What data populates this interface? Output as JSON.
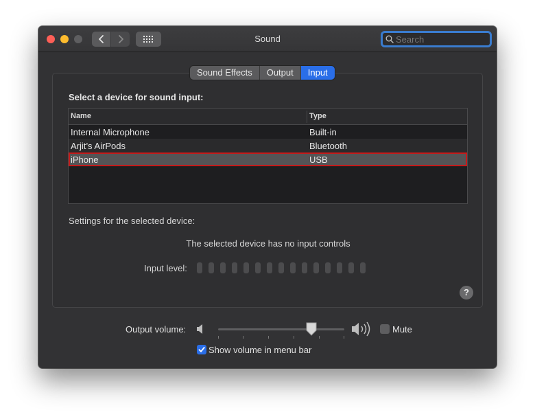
{
  "window": {
    "title": "Sound"
  },
  "search": {
    "placeholder": "Search"
  },
  "tabs": [
    {
      "label": "Sound Effects",
      "active": false
    },
    {
      "label": "Output",
      "active": false
    },
    {
      "label": "Input",
      "active": true
    }
  ],
  "input": {
    "heading": "Select a device for sound input:",
    "columns": {
      "name": "Name",
      "type": "Type"
    },
    "devices": [
      {
        "name": "Internal Microphone",
        "type": "Built-in",
        "selected": false
      },
      {
        "name": "Arjit’s AirPods",
        "type": "Bluetooth",
        "selected": false
      },
      {
        "name": "iPhone",
        "type": "USB",
        "selected": true
      }
    ],
    "settings_label": "Settings for the selected device:",
    "no_controls_text": "The selected device has no input controls",
    "input_level_label": "Input level:",
    "input_level_segments": 15,
    "input_level_value": 0
  },
  "help": {
    "label": "?"
  },
  "output_volume": {
    "label": "Output volume:",
    "level": 0.74
  },
  "mute": {
    "label": "Mute",
    "checked": false
  },
  "menu_bar": {
    "label": "Show volume in menu bar",
    "checked": true
  },
  "colors": {
    "accent": "#2a6ee8",
    "selection_highlight": "#c41b1b",
    "close": "#fe5f57",
    "minimize": "#febc2e"
  }
}
